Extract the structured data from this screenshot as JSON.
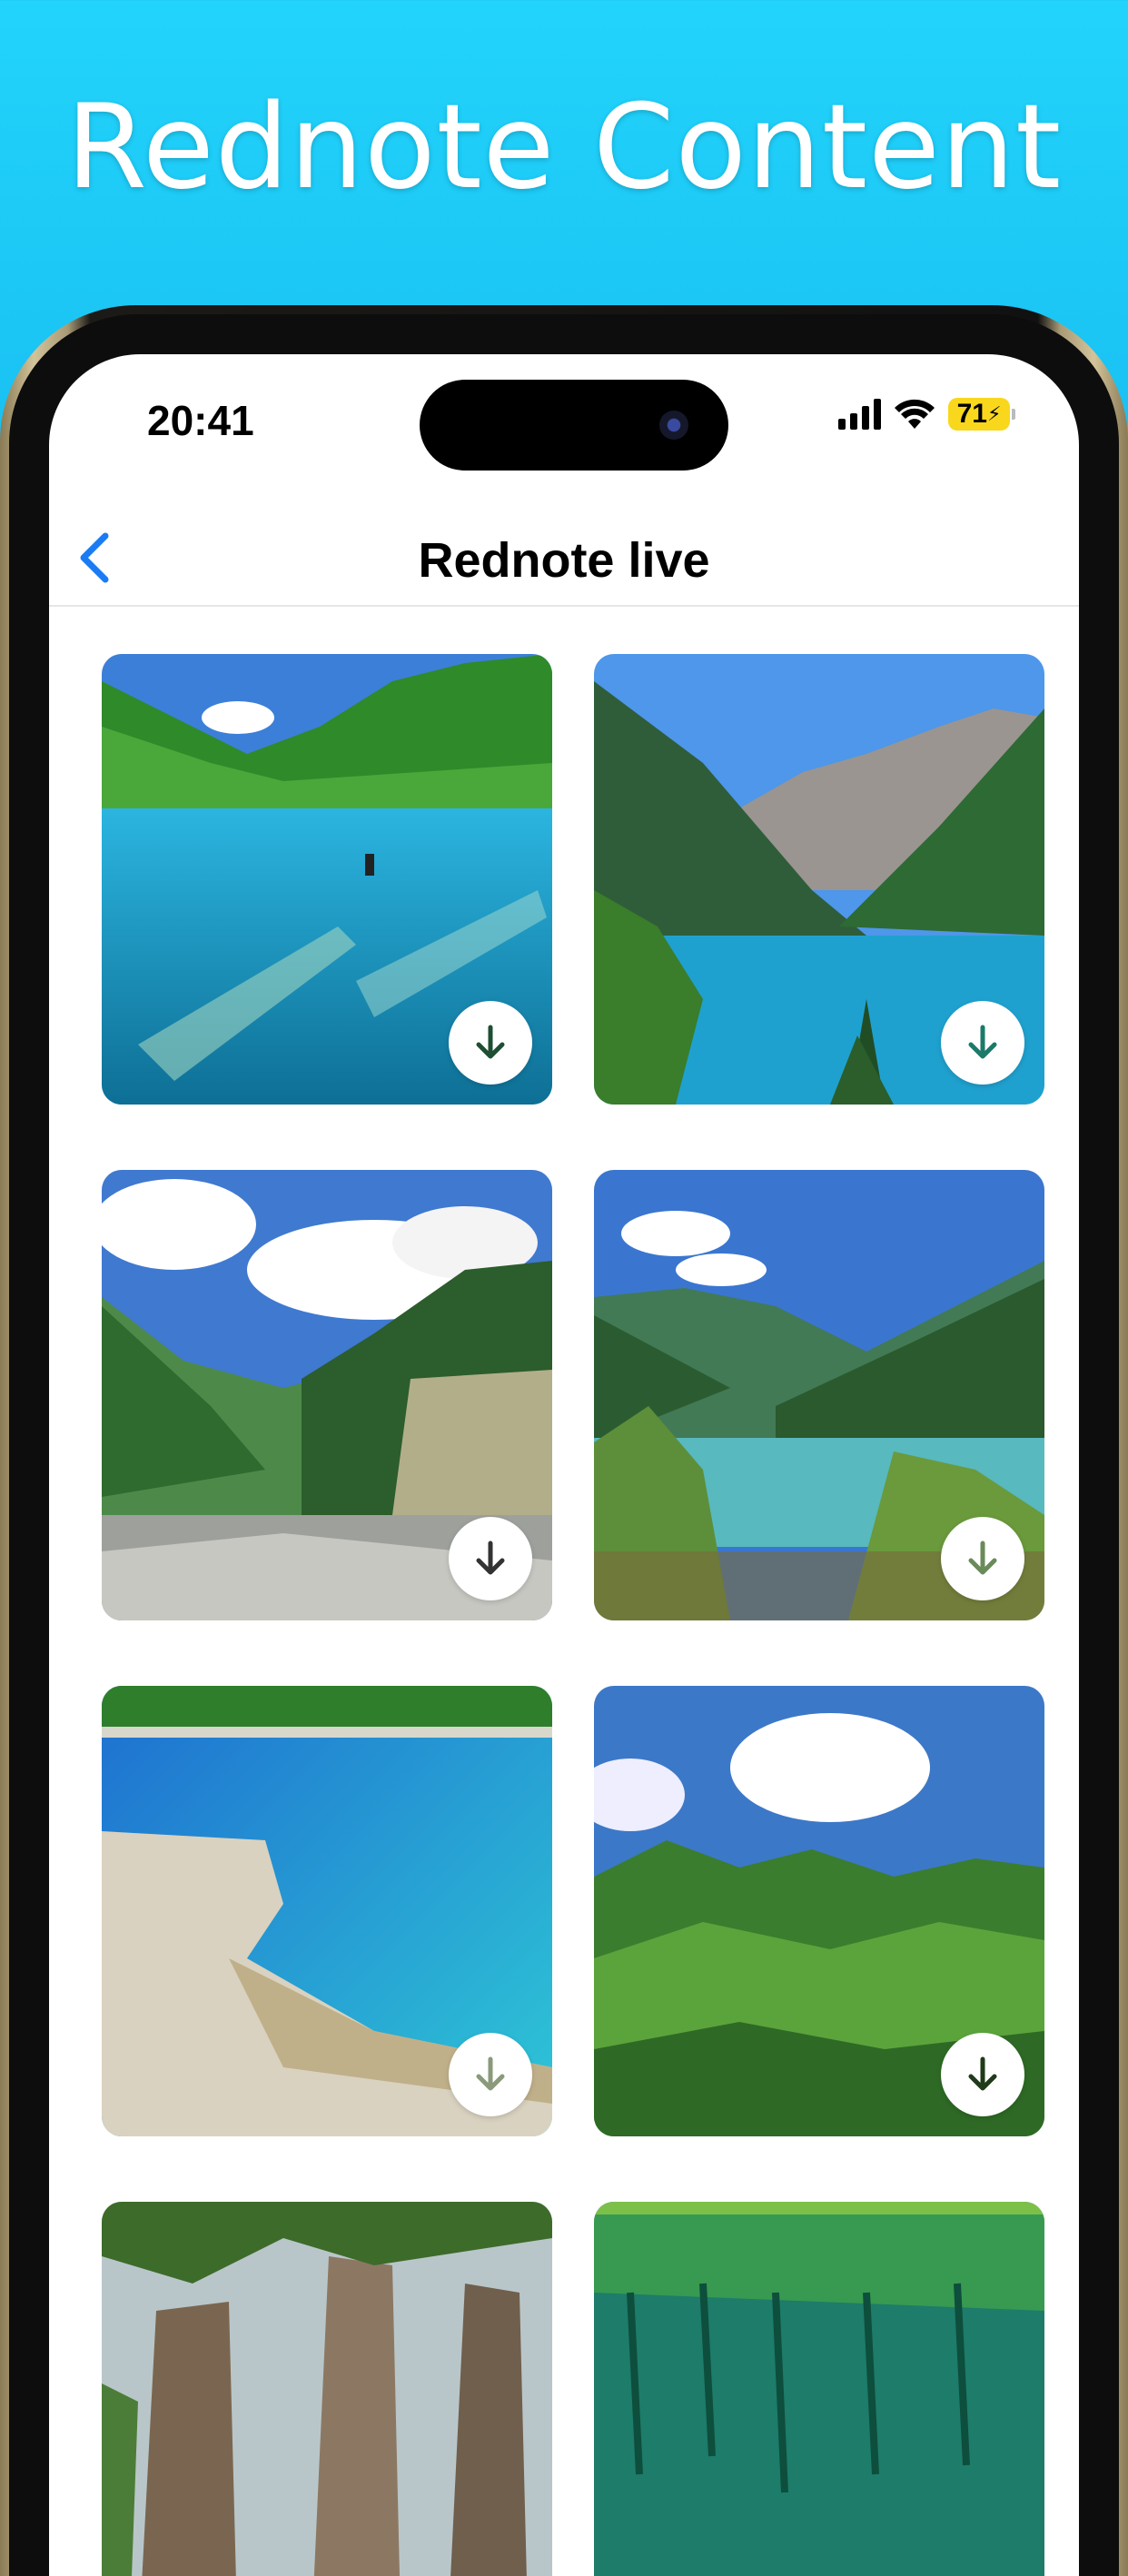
{
  "promo": {
    "title": "Rednote Content"
  },
  "status_bar": {
    "time": "20:41",
    "battery": "71"
  },
  "nav": {
    "title": "Rednote live",
    "back_icon": "chevron-left-icon"
  },
  "grid": {
    "items": [
      {
        "scene": "turquoise-lake-mountains",
        "download_icon": "download-icon"
      },
      {
        "scene": "alpine-lake-valley",
        "download_icon": "download-icon"
      },
      {
        "scene": "clouds-forest-rocks",
        "download_icon": "download-icon"
      },
      {
        "scene": "lake-with-trees",
        "download_icon": "download-icon"
      },
      {
        "scene": "blue-lake-shore",
        "download_icon": "download-icon"
      },
      {
        "scene": "cloudy-forest",
        "download_icon": "download-icon"
      },
      {
        "scene": "rock-pillars",
        "download_icon": ""
      },
      {
        "scene": "green-reflection-lake",
        "download_icon": ""
      }
    ]
  },
  "colors": {
    "accent_blue": "#1a7cf4",
    "battery_yellow": "#f9d71c"
  }
}
